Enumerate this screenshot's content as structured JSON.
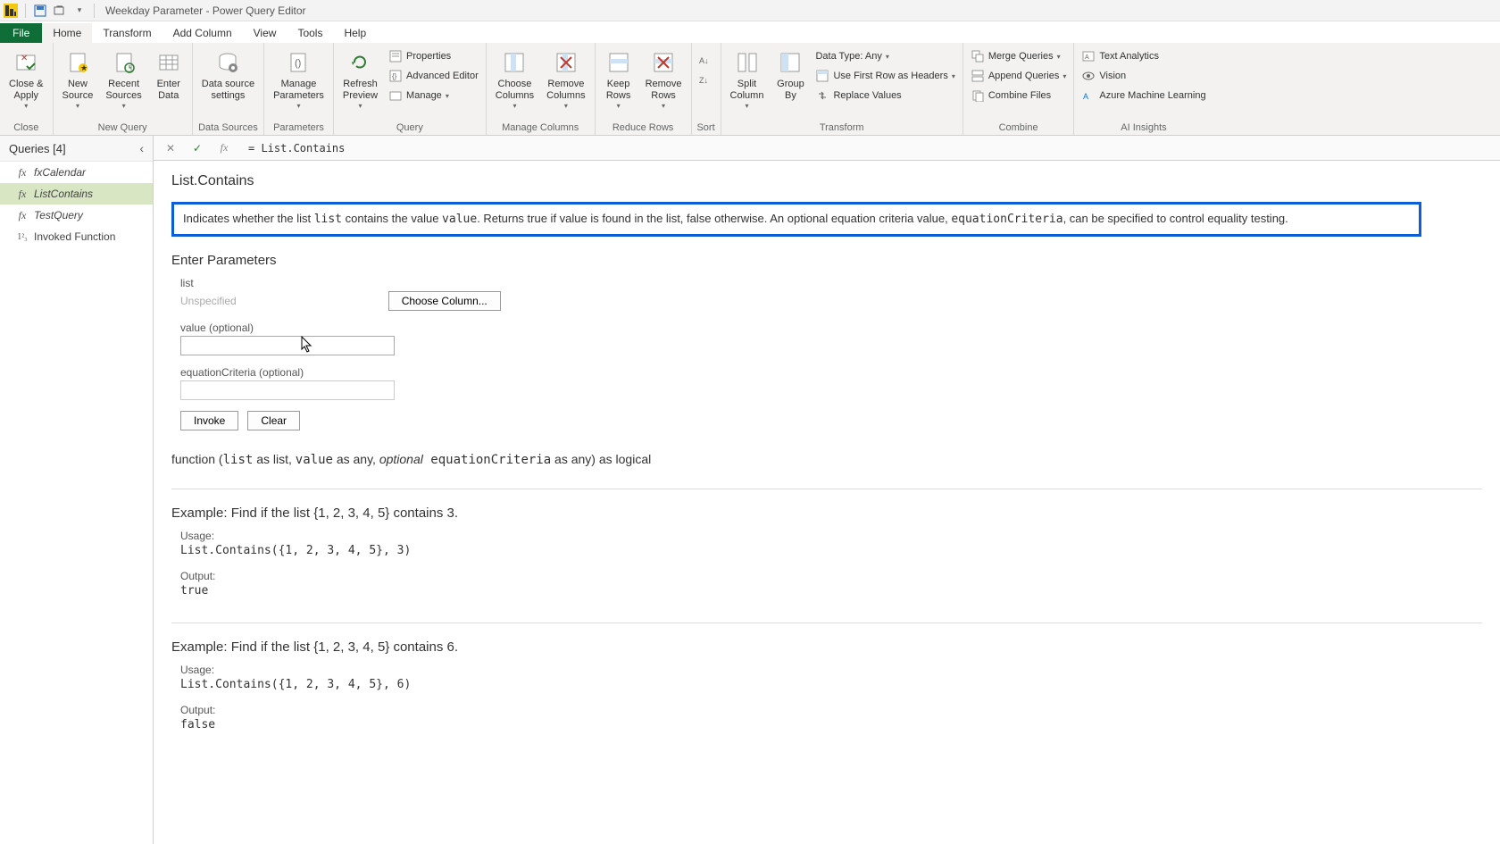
{
  "titlebar": {
    "title": "Weekday Parameter - Power Query Editor"
  },
  "menu": {
    "file": "File",
    "home": "Home",
    "transform": "Transform",
    "addcolumn": "Add Column",
    "view": "View",
    "tools": "Tools",
    "help": "Help"
  },
  "ribbon": {
    "close": {
      "apply": "Close &\nApply",
      "group": "Close"
    },
    "newquery": {
      "newsource": "New\nSource",
      "recent": "Recent\nSources",
      "enter": "Enter\nData",
      "group": "New Query"
    },
    "datasources": {
      "settings": "Data source\nsettings",
      "group": "Data Sources"
    },
    "parameters": {
      "manage": "Manage\nParameters",
      "group": "Parameters"
    },
    "query": {
      "refresh": "Refresh\nPreview",
      "properties": "Properties",
      "advanced": "Advanced Editor",
      "manage": "Manage",
      "group": "Query"
    },
    "managecols": {
      "choose": "Choose\nColumns",
      "remove": "Remove\nColumns",
      "group": "Manage Columns"
    },
    "reducerows": {
      "keep": "Keep\nRows",
      "removerows": "Remove\nRows",
      "group": "Reduce Rows"
    },
    "sort": {
      "group": "Sort"
    },
    "transform": {
      "split": "Split\nColumn",
      "groupby": "Group\nBy",
      "datatype": "Data Type: Any",
      "headers": "Use First Row as Headers",
      "replace": "Replace Values",
      "group": "Transform"
    },
    "combine": {
      "merge": "Merge Queries",
      "append": "Append Queries",
      "files": "Combine Files",
      "group": "Combine"
    },
    "ai": {
      "text": "Text Analytics",
      "vision": "Vision",
      "ml": "Azure Machine Learning",
      "group": "AI Insights"
    }
  },
  "queries": {
    "header": "Queries [4]",
    "items": [
      {
        "label": "fxCalendar"
      },
      {
        "label": "ListContains"
      },
      {
        "label": "TestQuery"
      },
      {
        "label": "Invoked Function"
      }
    ]
  },
  "formula": {
    "text": "= List.Contains"
  },
  "content": {
    "fn_title": "List.Contains",
    "desc_pre": "Indicates whether the list ",
    "desc_list": "list",
    "desc_mid1": " contains the value ",
    "desc_value": "value",
    "desc_mid2": ". Returns true if value is found in the list, false otherwise. An optional equation criteria value, ",
    "desc_eq": "equationCriteria",
    "desc_post": ", can be specified to control equality testing.",
    "enter_params": "Enter Parameters",
    "param1_label": "list",
    "param1_placeholder": "Unspecified",
    "choose_column": "Choose Column...",
    "param2_label": "value (optional)",
    "param3_label": "equationCriteria (optional)",
    "invoke": "Invoke",
    "clear": "Clear",
    "sig_pre": "function (",
    "sig_list": "list",
    "sig_aslist": " as list, ",
    "sig_value": "value",
    "sig_asany": " as any, ",
    "sig_optional": "optional",
    "sig_eq": " equationCriteria",
    "sig_post": " as any) as logical",
    "ex1_h": "Example: Find if the list {1, 2, 3, 4, 5} contains 3.",
    "usage": "Usage:",
    "ex1_code": "List.Contains({1, 2, 3, 4, 5}, 3)",
    "output": "Output:",
    "ex1_out": "true",
    "ex2_h": "Example: Find if the list {1, 2, 3, 4, 5} contains 6.",
    "ex2_code": "List.Contains({1, 2, 3, 4, 5}, 6)",
    "ex2_out": "false"
  }
}
